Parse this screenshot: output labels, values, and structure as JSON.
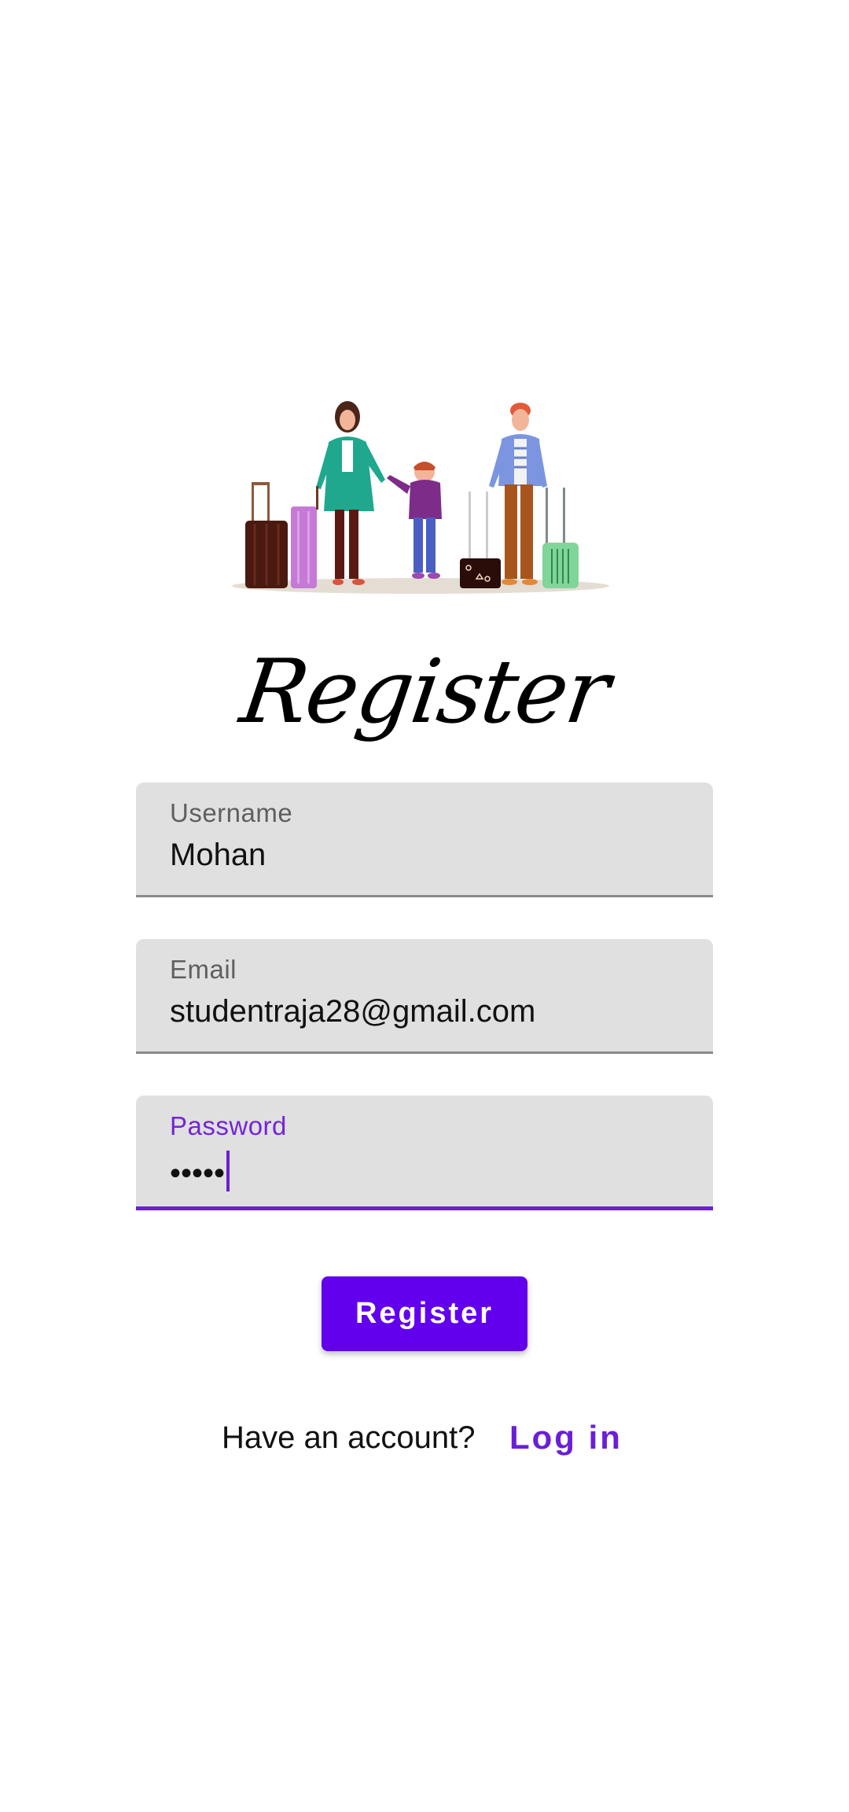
{
  "page": {
    "title": "Register"
  },
  "form": {
    "username": {
      "label": "Username",
      "value": "Mohan"
    },
    "email": {
      "label": "Email",
      "value": "studentraja28@gmail.com"
    },
    "password": {
      "label": "Password",
      "masked_value": "•••••"
    }
  },
  "actions": {
    "register_label": "Register"
  },
  "footer": {
    "prompt": "Have an account?",
    "login_label": "Log in"
  },
  "colors": {
    "accent": "#6200ee",
    "accent_text": "#6a1fd6",
    "field_bg": "#e0e0e0"
  },
  "icons": {
    "illustration": "family-travel-illustration"
  }
}
